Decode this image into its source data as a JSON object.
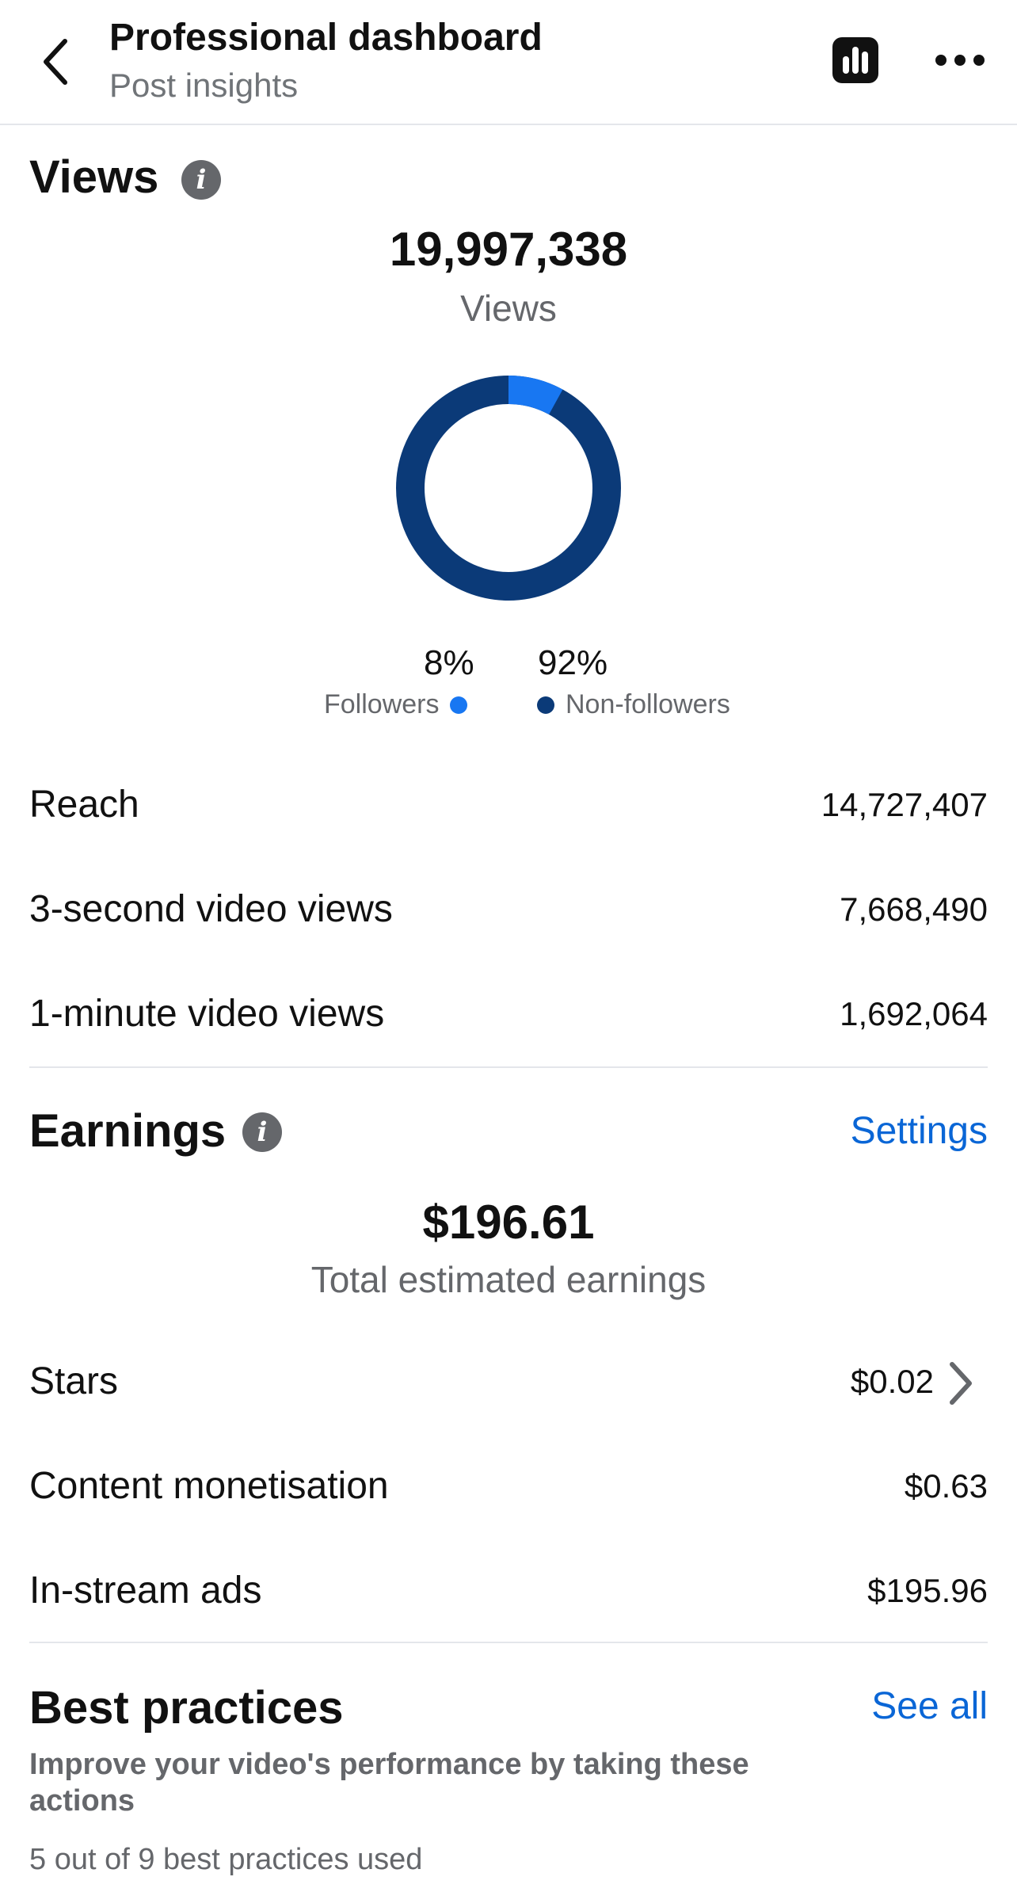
{
  "header": {
    "title": "Professional dashboard",
    "subtitle": "Post insights"
  },
  "views": {
    "section_title": "Views",
    "total": "19,997,338",
    "total_label": "Views",
    "breakdown": {
      "followers_pct": "8%",
      "followers_label": "Followers",
      "non_followers_pct": "92%",
      "non_followers_label": "Non-followers",
      "followers_fraction": 0.08,
      "followers_color": "#1877f2",
      "non_followers_color": "#0b3a78"
    },
    "metrics": [
      {
        "label": "Reach",
        "value": "14,727,407"
      },
      {
        "label": "3-second video views",
        "value": "7,668,490"
      },
      {
        "label": "1-minute video views",
        "value": "1,692,064"
      }
    ]
  },
  "earnings": {
    "section_title": "Earnings",
    "settings_label": "Settings",
    "total": "$196.61",
    "total_label": "Total estimated earnings",
    "items": [
      {
        "label": "Stars",
        "value": "$0.02"
      },
      {
        "label": "Content monetisation",
        "value": "$0.63"
      },
      {
        "label": "In-stream ads",
        "value": "$195.96"
      }
    ]
  },
  "best_practices": {
    "section_title": "Best practices",
    "see_all_label": "See all",
    "description": "Improve your video's performance by taking these actions",
    "count_text": "5 out of 9 best practices used"
  },
  "icons": {
    "back": "chevron-left-icon",
    "insights": "bar-chart-icon",
    "more": "more-horizontal-icon",
    "info": "info-icon",
    "chevron_right": "chevron-right-icon"
  },
  "colors": {
    "link": "#0a66d6",
    "followers": "#1877f2",
    "non_followers": "#0b3a78"
  }
}
